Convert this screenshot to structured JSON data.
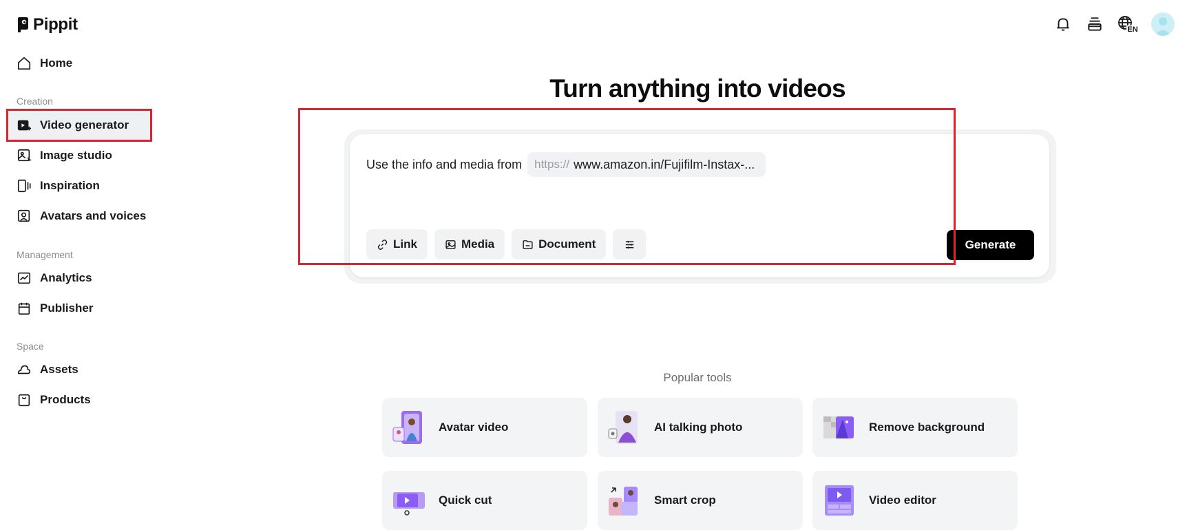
{
  "brand": {
    "name": "Pippit"
  },
  "sidebar": {
    "home": "Home",
    "sections": [
      {
        "label": "Creation"
      },
      {
        "label": "Management"
      },
      {
        "label": "Space"
      }
    ],
    "items": [
      {
        "label": "Video generator",
        "icon": "video-generator-icon",
        "active": true
      },
      {
        "label": "Image studio",
        "icon": "image-studio-icon"
      },
      {
        "label": "Inspiration",
        "icon": "inspiration-icon"
      },
      {
        "label": "Avatars and voices",
        "icon": "avatar-icon"
      },
      {
        "label": "Analytics",
        "icon": "analytics-icon"
      },
      {
        "label": "Publisher",
        "icon": "calendar-icon"
      },
      {
        "label": "Assets",
        "icon": "cloud-icon"
      },
      {
        "label": "Products",
        "icon": "bag-icon"
      }
    ]
  },
  "topbar": {
    "icons": [
      "bell-icon",
      "stack-icon",
      "globe-icon",
      "user-avatar"
    ],
    "language": "EN"
  },
  "main": {
    "title": "Turn anything into videos",
    "prompt": {
      "lead_text": "Use the info and media from",
      "url_prefix": "https://",
      "url_value": "www.amazon.in/Fujifilm-Instax-..."
    },
    "tools": [
      {
        "label": "Link",
        "icon": "link-icon"
      },
      {
        "label": "Media",
        "icon": "image-icon"
      },
      {
        "label": "Document",
        "icon": "folder-icon"
      }
    ],
    "settings_icon": "sliders-icon",
    "generate_label": "Generate"
  },
  "popular": {
    "label": "Popular tools",
    "items": [
      {
        "label": "Avatar video"
      },
      {
        "label": "AI talking photo"
      },
      {
        "label": "Remove background"
      },
      {
        "label": "Quick cut"
      },
      {
        "label": "Smart crop"
      },
      {
        "label": "Video editor"
      }
    ]
  },
  "colors": {
    "highlight": "#e0222c",
    "accent_purple": "#8b5cf6",
    "button_dark": "#000000"
  }
}
